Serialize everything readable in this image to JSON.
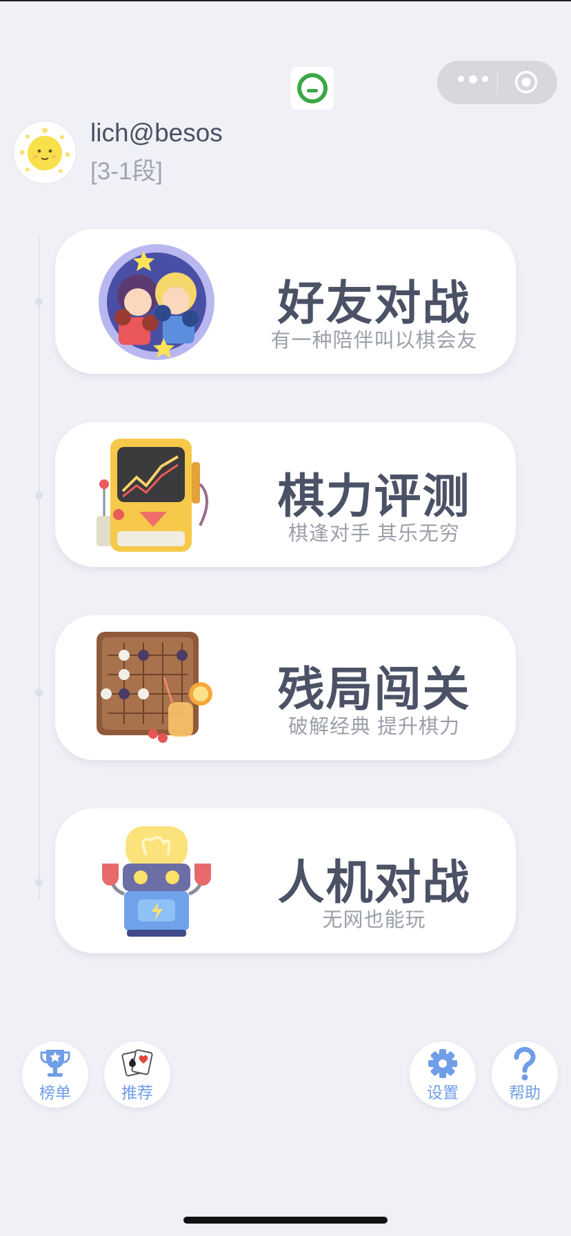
{
  "capsule": {
    "menu_icon": "more-dots-icon",
    "close_icon": "target-circle-icon"
  },
  "app_logo_icon": "chat-bubble-icon",
  "user": {
    "name": "lich@besos",
    "rank": "[3-1段]",
    "avatar_icon": "sun-face-avatar"
  },
  "menu": [
    {
      "title": "好友对战",
      "subtitle": "有一种陪伴叫以棋会友",
      "icon": "boxing-kids-icon"
    },
    {
      "title": "棋力评测",
      "subtitle": "棋逢对手 其乐无穷",
      "icon": "arcade-machine-icon"
    },
    {
      "title": "残局闯关",
      "subtitle": "破解经典 提升棋力",
      "icon": "go-board-icon"
    },
    {
      "title": "人机对战",
      "subtitle": "无网也能玩",
      "icon": "robot-icon"
    }
  ],
  "bottom": {
    "leaderboard": {
      "label": "榜单",
      "icon": "trophy-icon"
    },
    "recommend": {
      "label": "推荐",
      "icon": "playing-cards-icon"
    },
    "settings": {
      "label": "设置",
      "icon": "gear-icon"
    },
    "help": {
      "label": "帮助",
      "icon": "question-mark-icon"
    }
  },
  "colors": {
    "background": "#f0f1f6",
    "accent": "#6f9de8",
    "title_text": "#4b5266"
  }
}
